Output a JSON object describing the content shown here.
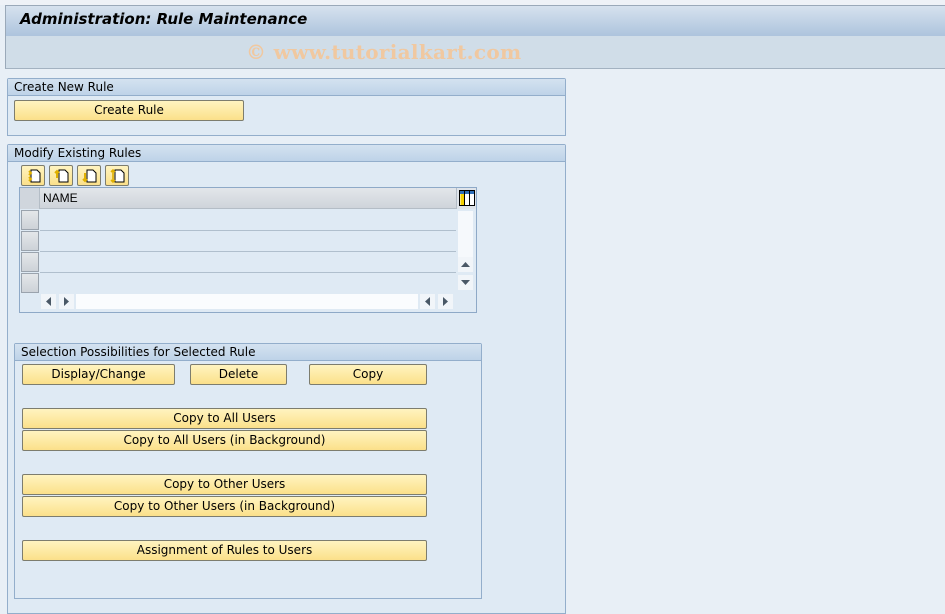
{
  "header": {
    "title": "Administration: Rule Maintenance",
    "watermark": "© www.tutorialkart.com"
  },
  "create_group": {
    "title": "Create New Rule",
    "create_button": "Create Rule"
  },
  "modify_group": {
    "title": "Modify Existing Rules",
    "toolbar_icons": [
      "insert-row-icon",
      "insert-above-icon",
      "insert-below-icon",
      "move-row-icon"
    ],
    "table": {
      "columns": [
        "NAME"
      ],
      "rows": [
        "",
        "",
        "",
        ""
      ]
    }
  },
  "selection_group": {
    "title": "Selection Possibilities for Selected Rule",
    "buttons": {
      "display_change": "Display/Change",
      "delete": "Delete",
      "copy": "Copy",
      "copy_all_users": "Copy to All Users",
      "copy_all_users_bg": "Copy to All Users (in Background)",
      "copy_other_users": "Copy to Other Users",
      "copy_other_users_bg": "Copy to Other Users (in Background)",
      "assignment": "Assignment of Rules to Users"
    }
  }
}
